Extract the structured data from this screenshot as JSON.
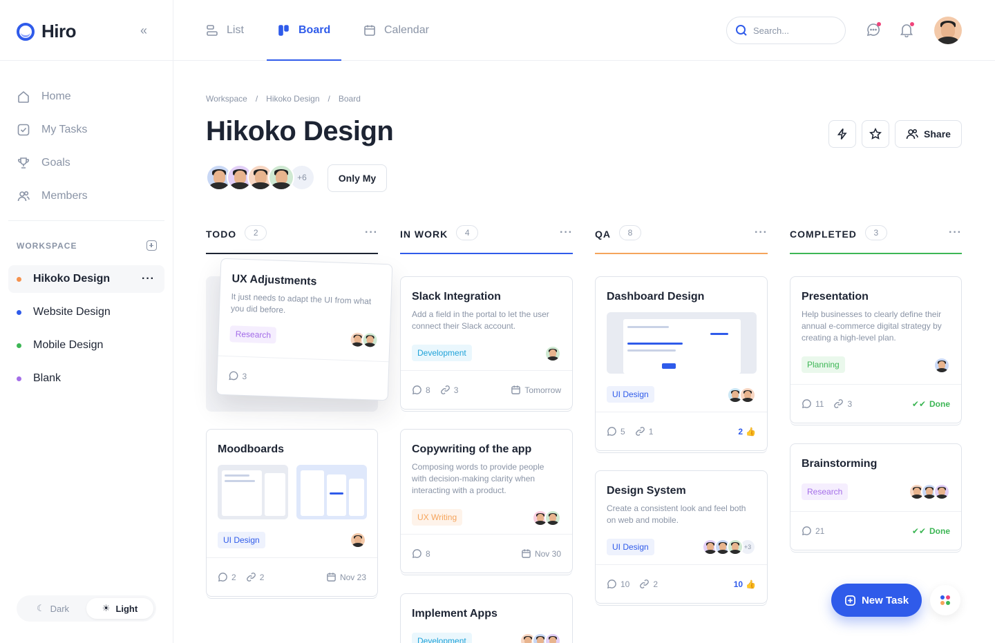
{
  "app": {
    "name": "Hiro"
  },
  "sidebar": {
    "nav": [
      {
        "label": "Home",
        "icon": "home-icon"
      },
      {
        "label": "My Tasks",
        "icon": "checkbox-icon"
      },
      {
        "label": "Goals",
        "icon": "trophy-icon"
      },
      {
        "label": "Members",
        "icon": "users-icon"
      }
    ],
    "workspace_label": "WORKSPACE",
    "workspaces": [
      {
        "label": "Hikoko Design",
        "color": "#f5924e",
        "active": true
      },
      {
        "label": "Website Design",
        "color": "#2f5bea",
        "active": false
      },
      {
        "label": "Mobile Design",
        "color": "#3db655",
        "active": false
      },
      {
        "label": "Blank",
        "color": "#a46ee8",
        "active": false
      }
    ],
    "theme": {
      "dark_label": "Dark",
      "light_label": "Light",
      "selected": "Light"
    }
  },
  "topbar": {
    "tabs": [
      {
        "label": "List",
        "icon": "list-icon"
      },
      {
        "label": "Board",
        "icon": "board-icon",
        "active": true
      },
      {
        "label": "Calendar",
        "icon": "calendar-icon"
      }
    ],
    "search_placeholder": "Search..."
  },
  "header": {
    "breadcrumb": [
      "Workspace",
      "/",
      "Hikoko Design",
      "/",
      "Board"
    ],
    "title": "Hikoko Design",
    "share_label": "Share",
    "members_more": "+6",
    "only_my_label": "Only My"
  },
  "columns": [
    {
      "title": "TODO",
      "count": "2",
      "color": "#1d2433"
    },
    {
      "title": "IN WORK",
      "count": "4",
      "color": "#2f5bea"
    },
    {
      "title": "QA",
      "count": "8",
      "color": "#f5a45b"
    },
    {
      "title": "COMPLETED",
      "count": "3",
      "color": "#3db655"
    }
  ],
  "cards": {
    "ux": {
      "title": "UX Adjustments",
      "desc": "It just needs to adapt the UI from what you did before.",
      "tag": "Research",
      "comments": "3"
    },
    "moodboards": {
      "title": "Moodboards",
      "tag": "UI Design",
      "comments": "2",
      "links": "2",
      "date": "Nov 23"
    },
    "slack": {
      "title": "Slack Integration",
      "desc": "Add a field in the portal to let the user connect their Slack account.",
      "tag": "Development",
      "comments": "8",
      "links": "3",
      "date": "Tomorrow"
    },
    "copy": {
      "title": "Copywriting of the app",
      "desc": "Composing words to provide people with decision-making clarity when interacting with a product.",
      "tag": "UX Writing",
      "comments": "8",
      "date": "Nov 30"
    },
    "implement": {
      "title": "Implement Apps",
      "tag": "Development"
    },
    "dashboard": {
      "title": "Dashboard Design",
      "tag": "UI Design",
      "comments": "5",
      "links": "1",
      "likes": "2"
    },
    "design_system": {
      "title": "Design System",
      "desc": "Create a consistent look and feel both on web and mobile.",
      "tag": "UI Design",
      "more": "+3",
      "comments": "10",
      "links": "2",
      "likes": "10"
    },
    "presentation": {
      "title": "Presentation",
      "desc": "Help businesses to clearly define their annual e-commerce digital strategy by creating a high-level plan.",
      "tag": "Planning",
      "comments": "11",
      "links": "3",
      "status": "Done"
    },
    "brainstorming": {
      "title": "Brainstorming",
      "tag": "Research",
      "comments": "21",
      "status": "Done"
    }
  },
  "fab": {
    "label": "New Task"
  }
}
